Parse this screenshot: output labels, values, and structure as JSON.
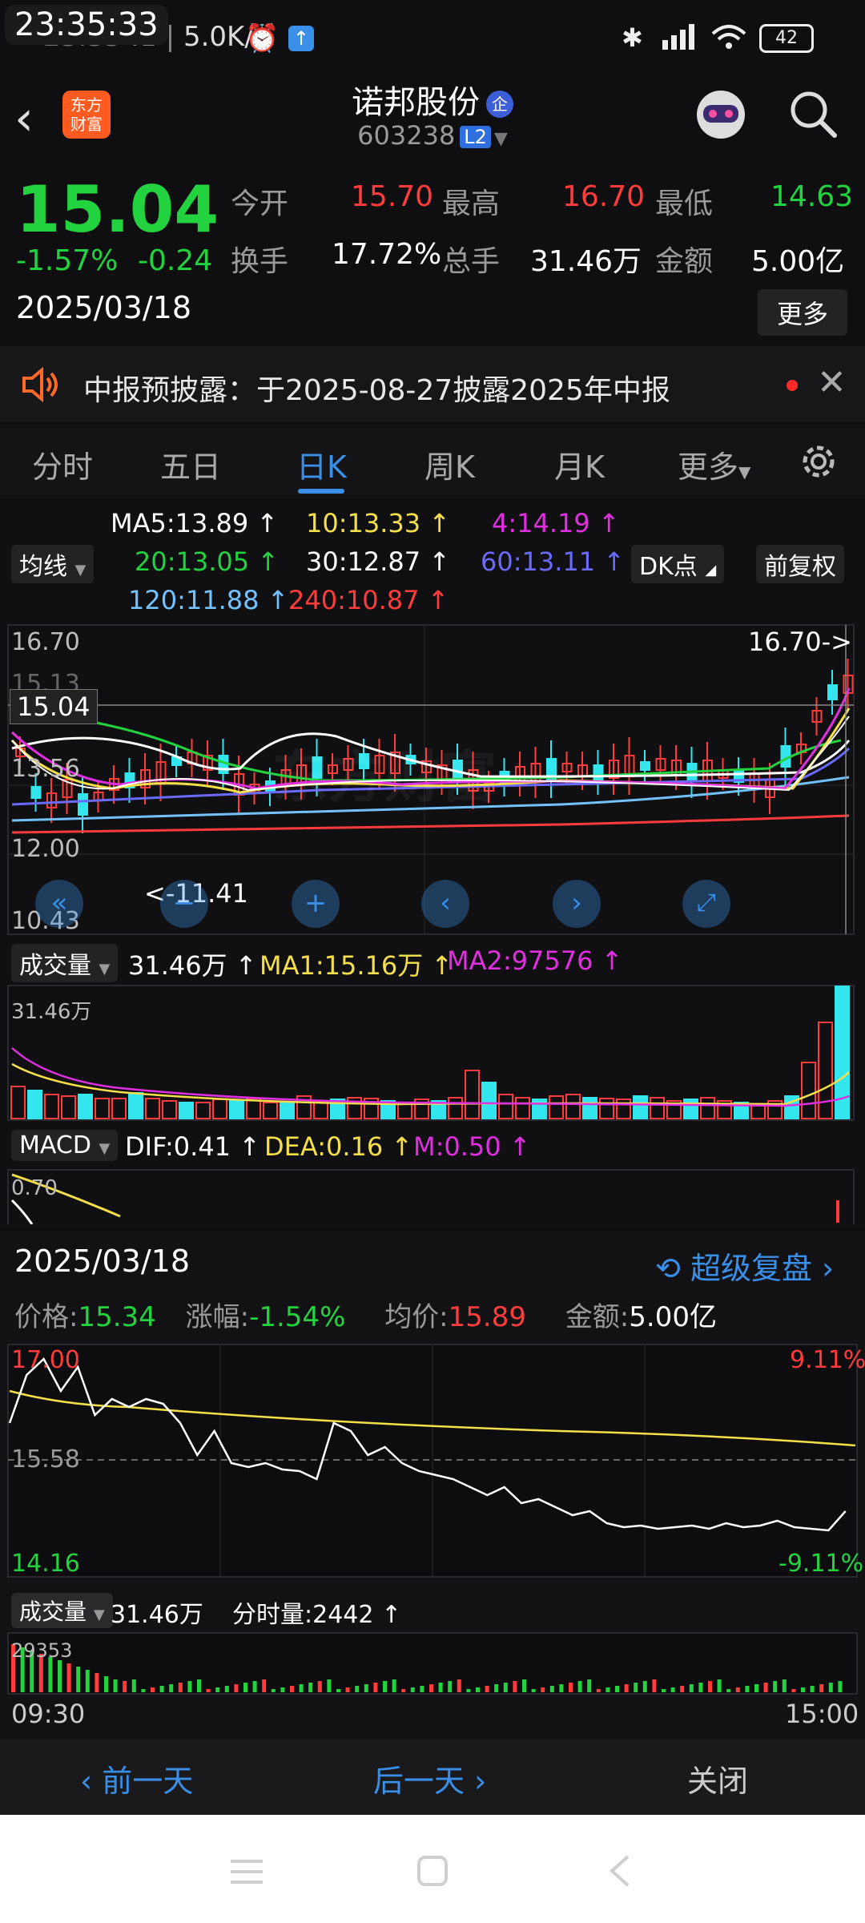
{
  "status_bar": {
    "clock": "23:35:33",
    "time_faded": "23:35",
    "net_speed": "5.0K/s",
    "battery": "42"
  },
  "header": {
    "logo_text": "东方\n财富",
    "stock_name": "诺邦股份",
    "qi_badge": "企",
    "stock_code": "603238",
    "level_badge": "L2"
  },
  "quote": {
    "price": "15.04",
    "change_pct": "-1.57%",
    "change": "-0.24",
    "date": "2025/03/18",
    "fields": [
      {
        "label": "今开",
        "value": "15.70",
        "color": "#ff3b3b"
      },
      {
        "label": "最高",
        "value": "16.70",
        "color": "#ff3b3b"
      },
      {
        "label": "最低",
        "value": "14.63",
        "color": "#23d23f"
      },
      {
        "label": "换手",
        "value": "17.72%",
        "color": "#ffffff"
      },
      {
        "label": "总手",
        "value": "31.46万",
        "color": "#ffffff"
      },
      {
        "label": "金额",
        "value": "5.00亿",
        "color": "#ffffff"
      }
    ],
    "more_button": "更多"
  },
  "notice": {
    "text": "中报预披露：于2025-08-27披露2025年中报"
  },
  "tabs": [
    "分时",
    "五日",
    "日K",
    "周K",
    "月K",
    "更多"
  ],
  "active_tab": "日K",
  "kline": {
    "ma_button": "均线",
    "dk_button": "DK点",
    "adjust_button": "前复权",
    "ma_values": [
      {
        "text": "MA5:13.89 ↑",
        "color": "#ffffff"
      },
      {
        "text": "10:13.33 ↑",
        "color": "#f5e04a"
      },
      {
        "text": "4:14.19 ↑",
        "color": "#e12ee1"
      },
      {
        "text": "20:13.05 ↑",
        "color": "#23d23f"
      },
      {
        "text": "30:12.87 ↑",
        "color": "#ffffff"
      },
      {
        "text": "60:13.11 ↑",
        "color": "#6a6aff"
      },
      {
        "text": "120:11.88 ↑",
        "color": "#73c2ff"
      },
      {
        "text": "240:10.87 ↑",
        "color": "#ff3b3b"
      }
    ],
    "price_labels": [
      "16.70",
      "15.13",
      "13.56",
      "12.00",
      "10.43"
    ],
    "current_price_tag": "15.04",
    "high_marker": "16.70->",
    "low_marker": "<-11.41",
    "watermark": "东方财富"
  },
  "volume": {
    "label": "成交量",
    "total": "31.46万 ↑",
    "ma1": "MA1:15.16万 ↑",
    "ma2": "MA2:97576 ↑",
    "axis_max": "31.46万"
  },
  "macd": {
    "label": "MACD",
    "dif": "DIF:0.41 ↑",
    "dea": "DEA:0.16 ↑",
    "m": "M:0.50 ↑",
    "axis": "0.70"
  },
  "intraday": {
    "date": "2025/03/18",
    "replay_link": "超级复盘",
    "price_label": "价格:",
    "price": "15.34",
    "chg_label": "涨幅:",
    "chg": "-1.54%",
    "avg_label": "均价:",
    "avg": "15.89",
    "amount_label": "金额:",
    "amount": "5.00亿",
    "y_top": "17.00",
    "y_mid": "15.58",
    "y_bottom": "14.16",
    "pct_top": "9.11%",
    "pct_bottom": "-9.11%",
    "vol_label": "成交量",
    "vol_total": "31.46万",
    "tick_vol": "分时量:2442 ↑",
    "vol_axis_max": "29353",
    "time_start": "09:30",
    "time_end": "15:00"
  },
  "bottom_nav": {
    "prev": "前一天",
    "next": "后一天",
    "close": "关闭"
  },
  "colors": {
    "accent": "#3a8fe8",
    "up": "#ff3b3b",
    "down": "#23d23f",
    "cyan_bar": "#33e6ee"
  }
}
